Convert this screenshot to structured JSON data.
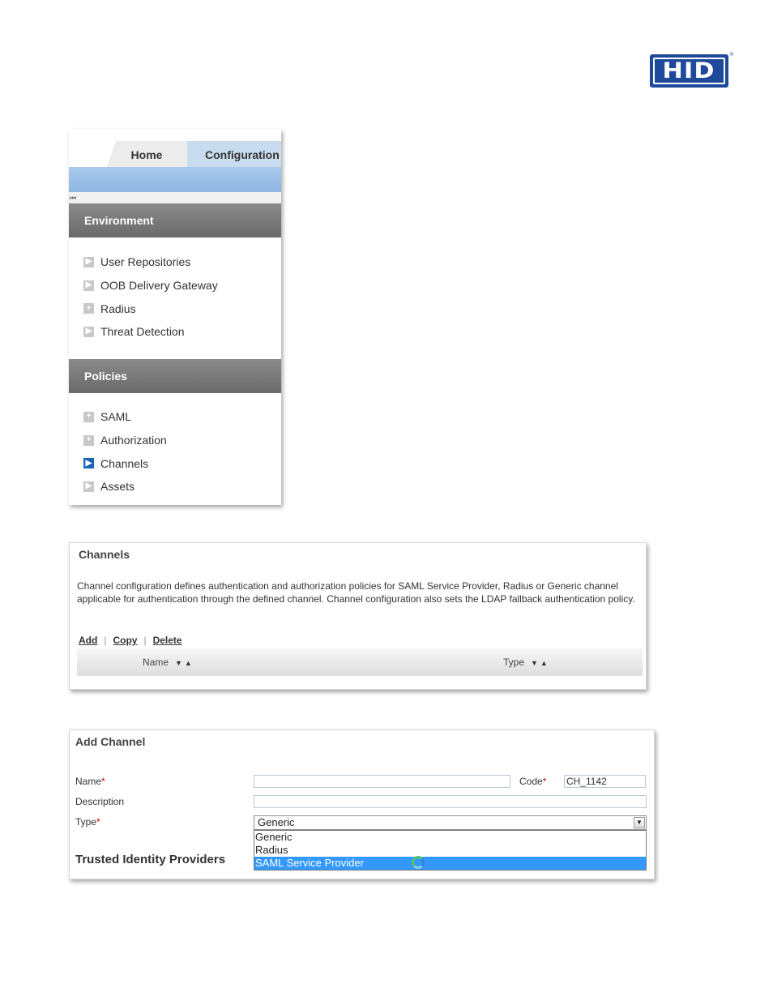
{
  "brand": {
    "logo_text": "HID",
    "registered": "®",
    "color": "#1f4a9c"
  },
  "nav": {
    "tabs": [
      {
        "label": "Home"
      },
      {
        "label": "Configuration",
        "active": true
      }
    ],
    "collapse_glyph": "⏮",
    "sections": [
      {
        "title": "Environment",
        "items": [
          {
            "label": "User Repositories",
            "icon": "chevron-right-icon",
            "glyph": "▶"
          },
          {
            "label": "OOB Delivery Gateway",
            "icon": "chevron-right-icon",
            "glyph": "▶"
          },
          {
            "label": "Radius",
            "icon": "plus-icon",
            "glyph": "+"
          },
          {
            "label": "Threat Detection",
            "icon": "chevron-right-icon",
            "glyph": "▶"
          }
        ]
      },
      {
        "title": "Policies",
        "items": [
          {
            "label": "SAML",
            "icon": "plus-icon",
            "glyph": "+"
          },
          {
            "label": "Authorization",
            "icon": "plus-icon",
            "glyph": "+"
          },
          {
            "label": "Channels",
            "icon": "chevron-right-icon",
            "glyph": "▶",
            "active": true
          },
          {
            "label": "Assets",
            "icon": "chevron-right-icon",
            "glyph": "▶"
          }
        ]
      }
    ]
  },
  "channels": {
    "title": "Channels",
    "description": "Channel configuration defines authentication and authorization policies for SAML Service Provider, Radius or Generic channel applicable for authentication through the defined channel. Channel configuration also sets the LDAP fallback authentication policy.",
    "actions": {
      "add": "Add",
      "copy": "Copy",
      "delete": "Delete",
      "separator": "|"
    },
    "columns": {
      "name": "Name",
      "type": "Type",
      "sort_glyph": "▼▲"
    }
  },
  "add_channel": {
    "title": "Add Channel",
    "required_mark": "*",
    "name_label": "Name",
    "name_value": "",
    "code_label": "Code",
    "code_value": "CH_1142",
    "description_label": "Description",
    "description_value": "",
    "type_label": "Type",
    "type_selected": "Generic",
    "dropdown_glyph": "▼",
    "type_options": [
      "Generic",
      "Radius",
      "SAML Service Provider"
    ],
    "highlighted_option": "SAML Service Provider",
    "trusted_idp_heading": "Trusted Identity Providers"
  }
}
